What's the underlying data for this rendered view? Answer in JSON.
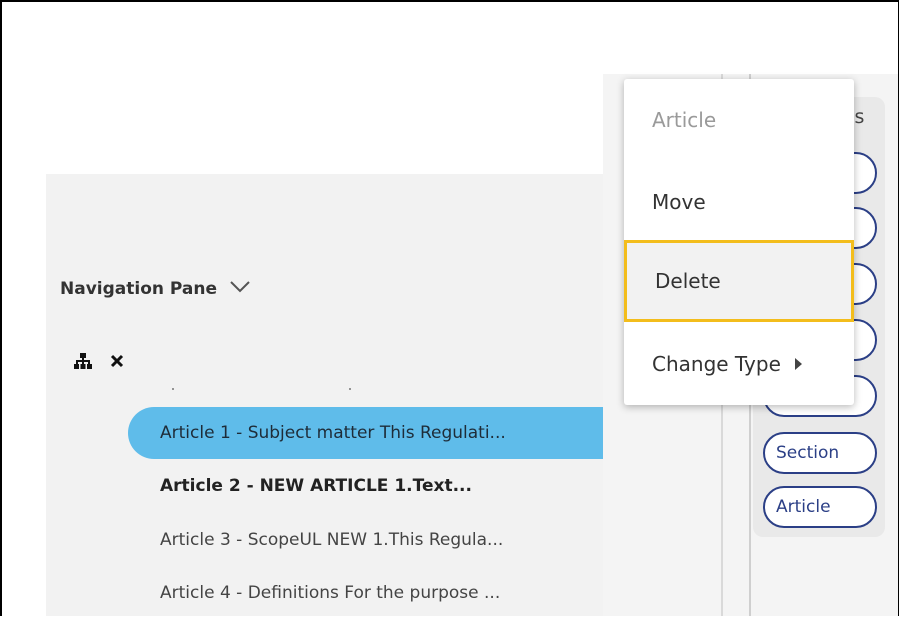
{
  "navigation_pane": {
    "title": "Navigation Pane",
    "title_icon": "chevron-down-icon",
    "tools": [
      "hierarchy-icon",
      "close-icon"
    ],
    "rows": [
      {
        "label": "Article 1 - Subject matter This Regulati...",
        "selected": true,
        "bold": false
      },
      {
        "label": "Article 2 - NEW ARTICLE 1.Text...",
        "selected": false,
        "bold": true
      },
      {
        "label": "Article 3 - ScopeUL NEW 1.This Regula...",
        "selected": false,
        "bold": false
      },
      {
        "label": "Article 4 - Definitions For the purpose ...",
        "selected": false,
        "bold": false
      }
    ]
  },
  "context_menu": {
    "header": "Article",
    "items": [
      "Move",
      "Delete",
      "Change Type"
    ],
    "highlighted": "Delete",
    "highlight_color": "#f3bd1c"
  },
  "elements_panel": {
    "title_partial": "ts",
    "pills": [
      "",
      "",
      "",
      "",
      "",
      "Section",
      "Article"
    ]
  },
  "colors": {
    "selection": "#5fbcea",
    "pill_border": "#2b3f86"
  }
}
